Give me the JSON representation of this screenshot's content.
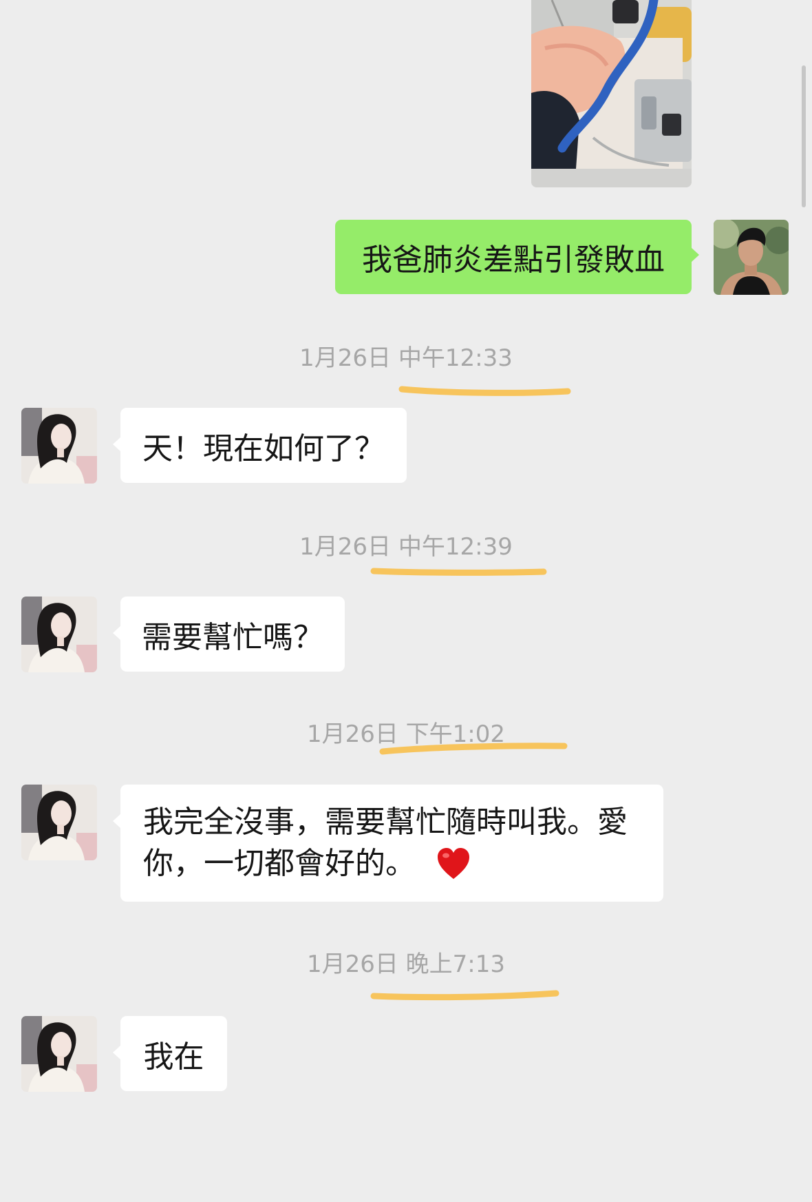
{
  "theme": {
    "background": "#ededed",
    "sent_bubble": "#95ec69",
    "received_bubble": "#ffffff",
    "timestamp_color": "#a6a6a6",
    "highlight_color": "#f7c45c"
  },
  "chat": {
    "sent_photo_icon": "photo-thumbnail",
    "sent": {
      "text": "我爸肺炎差點引發敗血"
    },
    "timestamps": [
      "1月26日 中午12:33",
      "1月26日 中午12:39",
      "1月26日 下午1:02",
      "1月26日 晚上7:13"
    ],
    "received": [
      {
        "lines": [
          "天！現在如何了？"
        ]
      },
      {
        "lines": [
          "需要幫忙嗎？"
        ]
      },
      {
        "lines": [
          "我完全沒事，需要幫忙隨時叫我。愛",
          "你，一切都會好的。"
        ],
        "emoji": "red-heart-icon"
      },
      {
        "lines": [
          "我在"
        ]
      }
    ]
  }
}
